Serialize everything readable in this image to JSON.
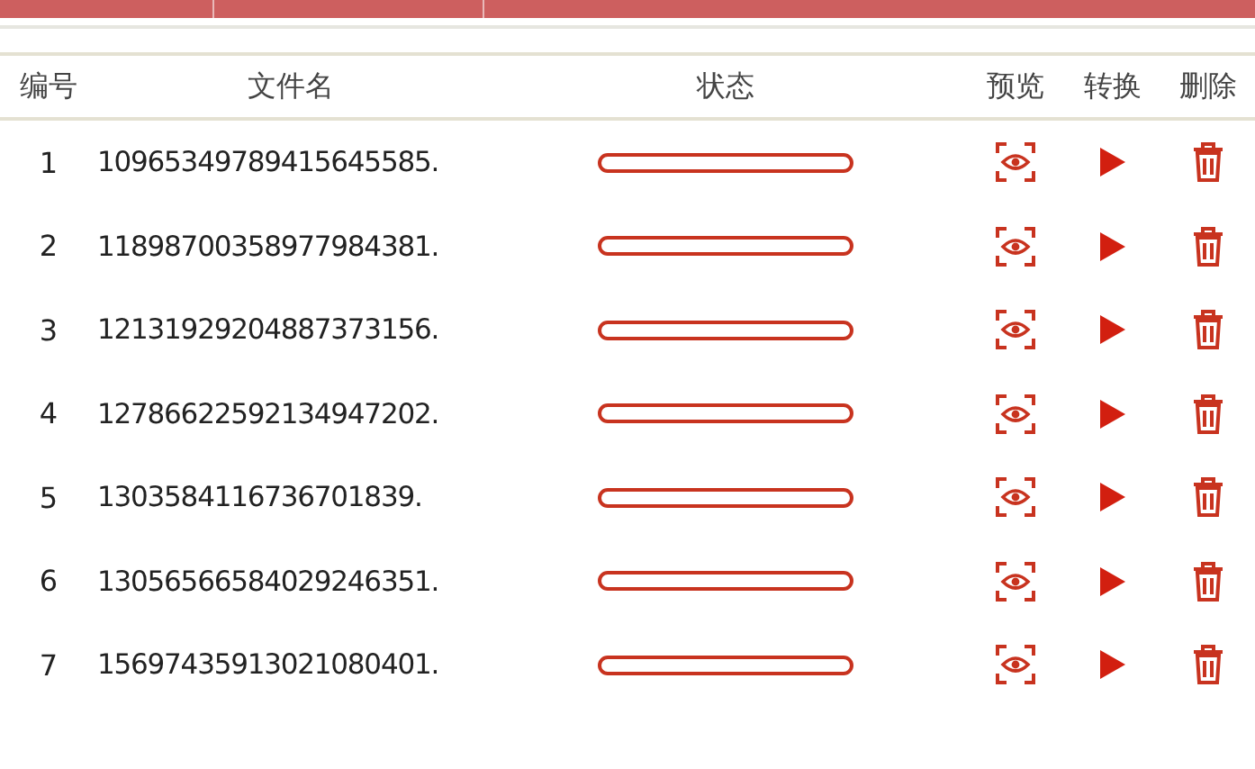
{
  "columns": [
    "编号",
    "文件名",
    "状态",
    "预览",
    "转换",
    "删除"
  ],
  "rows": [
    {
      "index": "1",
      "filename": "10965349789415645585.",
      "level": 0
    },
    {
      "index": "2",
      "filename": "11898700358977984381.",
      "level": 0
    },
    {
      "index": "3",
      "filename": "12131929204887373156.",
      "level": 0
    },
    {
      "index": "4",
      "filename": "12786622592134947202.",
      "level": 0
    },
    {
      "index": "5",
      "filename": "1303584116736701839.",
      "level": 0
    },
    {
      "index": "6",
      "filename": "13056566584029246351.",
      "level": 0
    },
    {
      "index": "7",
      "filename": "15697435913021080401.",
      "level": 0
    }
  ]
}
